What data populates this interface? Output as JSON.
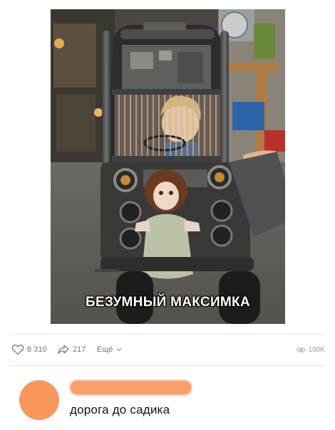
{
  "post": {
    "image_caption": "БЕЗУМНЫЙ МАКСИМКА",
    "likes": "8 310",
    "shares": "217",
    "more_label": "Ещё",
    "views": "180K"
  },
  "comment": {
    "text": "дорога до садика"
  },
  "icons": {
    "like": "heart-icon",
    "share": "share-arrow-icon",
    "more": "chevron-down-icon",
    "views": "eye-icon"
  },
  "colors": {
    "avatar": "#f7975a",
    "meta_text": "#6d7885"
  }
}
